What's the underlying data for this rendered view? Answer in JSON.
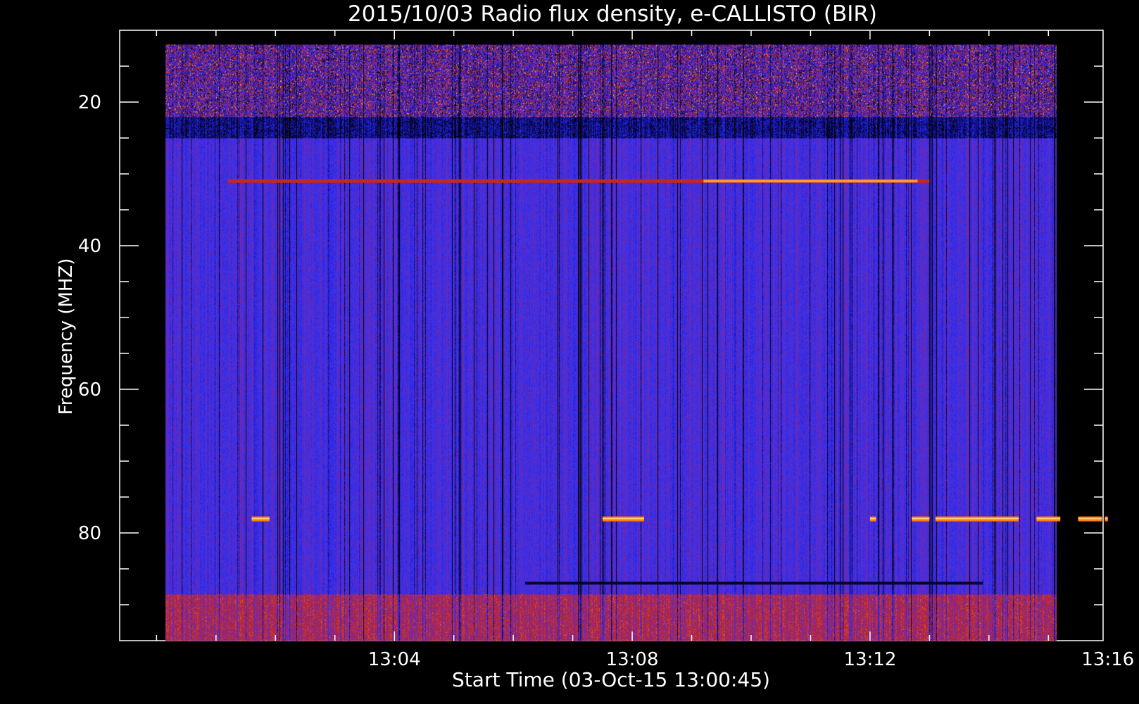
{
  "chart_data": {
    "type": "heatmap",
    "title": "2015/10/03  Radio flux density, e-CALLISTO (BIR)",
    "xlabel": "Start Time (03-Oct-15 13:00:45)",
    "ylabel": "Frequency (MHZ)",
    "x_axis": {
      "unit": "minutes after 13:00",
      "range": [
        -0.62,
        15.92
      ],
      "data_range": [
        0.15,
        15.14
      ],
      "major_ticks": [
        4,
        8,
        12,
        16
      ],
      "tick_labels": [
        "13:04",
        "13:08",
        "13:12",
        "13:16"
      ],
      "minor_step": 1
    },
    "y_axis": {
      "unit": "MHz",
      "range": [
        10,
        95
      ],
      "data_range": [
        12,
        95
      ],
      "inverted": true,
      "major_ticks": [
        20,
        40,
        60,
        80
      ],
      "tick_labels": [
        "20",
        "40",
        "60",
        "80"
      ],
      "minor_step": 5
    },
    "colormap": [
      "#000000",
      "#1a1ad8",
      "#3535f4",
      "#8a2290",
      "#c4281e",
      "#ff6a00",
      "#ffd050"
    ],
    "background_level": "blue",
    "features": [
      {
        "kind": "noisy-band",
        "freq_range": [
          12,
          22
        ],
        "description": "interference with red/orange speckle"
      },
      {
        "kind": "dark-band",
        "freq_range": [
          22,
          25
        ]
      },
      {
        "kind": "narrowband-emission",
        "freq": 31,
        "time_range": [
          1.2,
          13.0
        ],
        "peak_time": 11.0
      },
      {
        "kind": "narrowband-emission",
        "freq": 78,
        "segments": [
          [
            1.6,
            1.9
          ],
          [
            7.5,
            8.2
          ],
          [
            12.0,
            12.1
          ],
          [
            12.7,
            13.0
          ],
          [
            13.1,
            14.5
          ],
          [
            14.8,
            15.2
          ],
          [
            15.5,
            15.9
          ],
          [
            15.95,
            16.0
          ]
        ]
      },
      {
        "kind": "dark-band",
        "freq": 87,
        "time_range": [
          6.2,
          13.9
        ]
      },
      {
        "kind": "noisy-band",
        "freq_range": [
          89,
          95
        ],
        "description": "reddish low-level emission"
      }
    ]
  }
}
